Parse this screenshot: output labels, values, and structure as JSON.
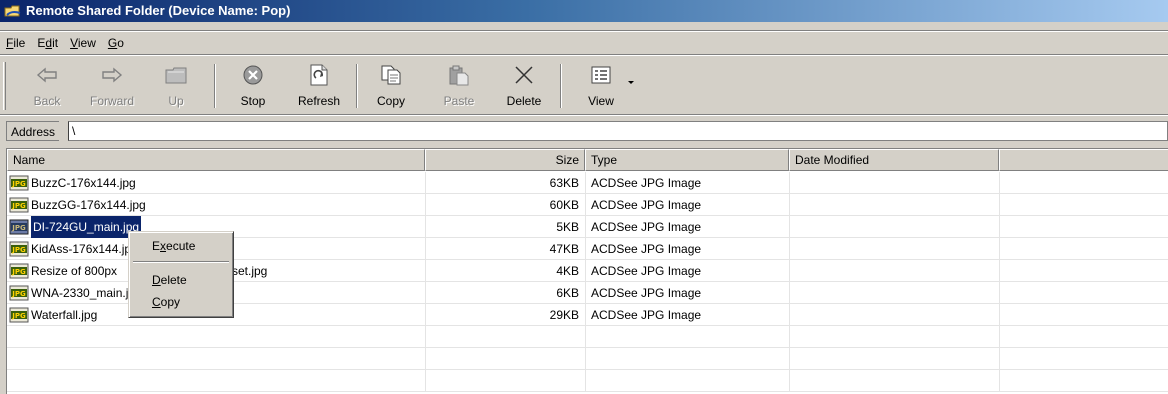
{
  "window": {
    "title": "Remote Shared Folder (Device Name: Pop)"
  },
  "menu": {
    "items": [
      {
        "key": "F",
        "rest": "ile"
      },
      {
        "key": "",
        "pre": "E",
        "key2": "d",
        "rest": "it"
      },
      {
        "key": "V",
        "rest": "iew"
      },
      {
        "key": "G",
        "rest": "o"
      }
    ],
    "file_key": "F",
    "file_rest": "ile",
    "edit_pre": "E",
    "edit_key": "d",
    "edit_rest": "it",
    "view_key": "V",
    "view_rest": "iew",
    "go_key": "G",
    "go_rest": "o"
  },
  "toolbar": {
    "back": "Back",
    "forward": "Forward",
    "up": "Up",
    "stop": "Stop",
    "refresh": "Refresh",
    "copy": "Copy",
    "paste": "Paste",
    "delete": "Delete",
    "view": "View"
  },
  "address": {
    "label": "Address",
    "value": "\\"
  },
  "columns": {
    "name": "Name",
    "size": "Size",
    "type": "Type",
    "date": "Date Modified"
  },
  "icon_label": "JPG",
  "files": [
    {
      "name": "BuzzC-176x144.jpg",
      "size": "63KB",
      "type": "ACDSee JPG Image"
    },
    {
      "name": "BuzzGG-176x144.jpg",
      "size": "60KB",
      "type": "ACDSee JPG Image"
    },
    {
      "name": "DI-724GU_main.jpg",
      "size": "5KB",
      "type": "ACDSee JPG Image"
    },
    {
      "name": "KidAss-176x144.jpg",
      "size": "47KB",
      "type": "ACDSee JPG Image"
    },
    {
      "name": "Resize of 800px",
      "name_tail": "set.jpg",
      "size": "4KB",
      "type": "ACDSee JPG Image"
    },
    {
      "name": "WNA-2330_main.jpg",
      "size": "6KB",
      "type": "ACDSee JPG Image"
    },
    {
      "name": "Waterfall.jpg",
      "size": "29KB",
      "type": "ACDSee JPG Image"
    }
  ],
  "context_menu": {
    "execute_pre": "E",
    "execute_key": "x",
    "execute_rest": "ecute",
    "delete_key": "D",
    "delete_rest": "elete",
    "copy_key": "C",
    "copy_rest": "opy"
  }
}
